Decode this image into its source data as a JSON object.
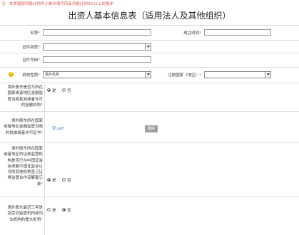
{
  "note": "注：本表需按持股比例大小依次填写所有持股比例5%以上的股东",
  "title": "出资人基本信息表（适用法人及其他组织）",
  "fields": {
    "name_label": "名称",
    "established_label": "成立时间",
    "cert_type_label": "证件类型",
    "cert_no_label": "证件号码",
    "org_nature_label": "机构性质",
    "org_nature_value": "境外机构",
    "reg_country_label": "注册国家（地区）",
    "req_mark": "*"
  },
  "q1": {
    "lines": [
      "境外股东是否为所在",
      "国家或者地区金融监",
      "管当局批准或者许可",
      "的金融机构"
    ],
    "req": "*",
    "yes": "是",
    "no": "否"
  },
  "q2": {
    "lines": [
      "境外股东所在国家",
      "或者地区金融监管当局",
      "的批准或者许可证书"
    ],
    "req": "*",
    "file": "空.pdf",
    "delete_label": "删除"
  },
  "q3": {
    "lines": [
      "境外股东所在国家",
      "或者地区的证券监管机",
      "构是否已与中国证监",
      "会或者中国证监会认",
      "可的其他机构签订证",
      "券监管合作谅解备忘",
      "录"
    ],
    "req": "*",
    "yes": "是",
    "no": "否"
  },
  "q4": {
    "lines": [
      "境外股东最近三年是",
      "否受到监管机构或司",
      "法机构的重大处罚"
    ],
    "req": "*",
    "yes": "是",
    "no": "否"
  },
  "icons": {
    "info": "lightbulb-icon",
    "dropdown": "chevron-down-icon"
  }
}
